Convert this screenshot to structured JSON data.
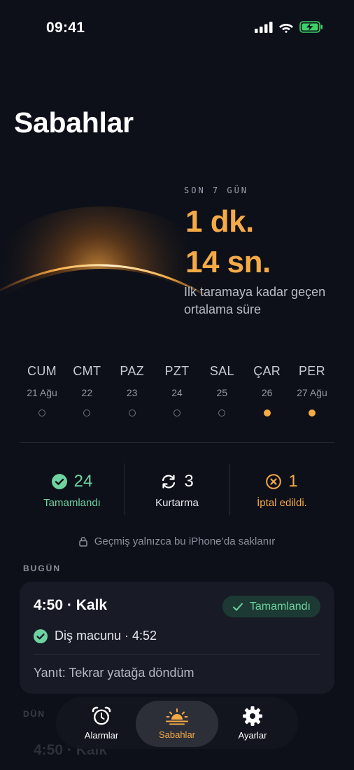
{
  "status_bar": {
    "time": "09:41"
  },
  "page": {
    "title": "Sabahlar"
  },
  "summary": {
    "kicker": "SON 7 GÜN",
    "minutes": "1 dk.",
    "seconds": "14 sn.",
    "description": "İlk taramaya kadar geçen ortalama süre"
  },
  "week": [
    {
      "day": "CUM",
      "date": "21 Ağu",
      "done": false
    },
    {
      "day": "CMT",
      "date": "22",
      "done": false
    },
    {
      "day": "PAZ",
      "date": "23",
      "done": false
    },
    {
      "day": "PZT",
      "date": "24",
      "done": false
    },
    {
      "day": "SAL",
      "date": "25",
      "done": false
    },
    {
      "day": "ÇAR",
      "date": "26",
      "done": true
    },
    {
      "day": "PER",
      "date": "27 Ağu",
      "done": true
    }
  ],
  "stats": {
    "completed": {
      "value": "24",
      "label": "Tamamlandı",
      "color": "#6ed3a0"
    },
    "recovery": {
      "value": "3",
      "label": "Kurtarma",
      "color": "#ffffff"
    },
    "cancelled": {
      "value": "1",
      "label": "İptal edildi.",
      "color": "#f5aa46"
    }
  },
  "privacy_note": "Geçmiş yalnızca bu iPhone’da saklanır",
  "section_label": "BUGÜN",
  "card": {
    "title": "4:50 · Kalk",
    "badge": "Tamamlandı",
    "task": "Diş macunu · 4:52",
    "answer": "Yanıt: Tekrar yatağa döndüm"
  },
  "tabs": [
    {
      "label": "Alarmlar",
      "icon": "alarm-clock-icon",
      "active": false
    },
    {
      "label": "Sabahlar",
      "icon": "sunrise-icon",
      "active": true
    },
    {
      "label": "Ayarlar",
      "icon": "gear-icon",
      "active": false
    }
  ],
  "colors": {
    "accent": "#f5aa46",
    "success": "#6ed3a0",
    "background": "#0d1019"
  }
}
